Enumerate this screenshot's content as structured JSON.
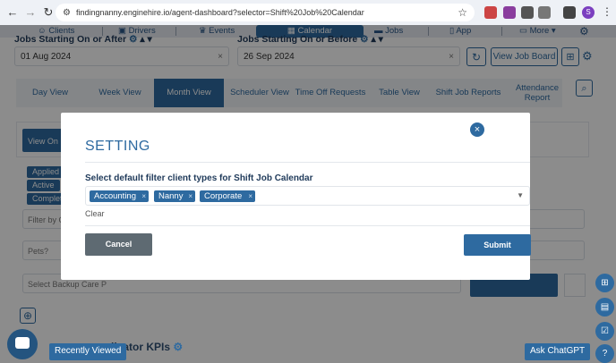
{
  "browser": {
    "url": "findingnanny.enginehire.io/agent-dashboard?selector=Shift%20Job%20Calendar",
    "profile_initial": "S"
  },
  "appnav": {
    "items": [
      {
        "label": "Clients",
        "icon": "people-icon"
      },
      {
        "label": "Drivers",
        "icon": "car-icon"
      },
      {
        "label": "Events",
        "icon": "trophy-icon"
      },
      {
        "label": "Calendar",
        "icon": "calendar-icon",
        "active": true
      },
      {
        "label": "Jobs",
        "icon": "briefcase-icon"
      },
      {
        "label": "App",
        "icon": "phone-icon"
      },
      {
        "label": "More",
        "icon": "chat-icon"
      }
    ]
  },
  "filters": {
    "start_label": "Jobs Starting On or After",
    "start_value": "01 Aug 2024",
    "end_label": "Jobs Starting On or Before",
    "end_value": "26 Sep 2024",
    "view_job_board": "View Job Board"
  },
  "view_tabs": [
    {
      "label": "Day View"
    },
    {
      "label": "Week View"
    },
    {
      "label": "Month View",
      "active": true
    },
    {
      "label": "Scheduler View"
    },
    {
      "label": "Time Off Requests"
    },
    {
      "label": "Table View"
    },
    {
      "label": "Shift Job Reports"
    },
    {
      "label": "Attendance Report"
    }
  ],
  "background": {
    "view_on_btn": "View On",
    "chips": [
      "Applied",
      "Active",
      "Complet"
    ],
    "filter_placeholder": "Filter by C",
    "pets_placeholder": "Pets?",
    "backup_placeholder": "Select Backup Care P"
  },
  "modal": {
    "title": "SETTING",
    "field_label": "Select default filter client types for Shift Job Calendar",
    "tags": [
      "Accounting",
      "Nanny",
      "Corporate"
    ],
    "clear": "Clear",
    "cancel": "Cancel",
    "submit": "Submit"
  },
  "bottom": {
    "recently_viewed": "Recently Viewed",
    "kpi_title": "dicator KPIs",
    "ask_chatgpt": "Ask ChatGPT"
  },
  "colors": {
    "brand": "#2e6aa0",
    "modal_title": "#2e6aa0",
    "cancel": "#5e6a72"
  }
}
